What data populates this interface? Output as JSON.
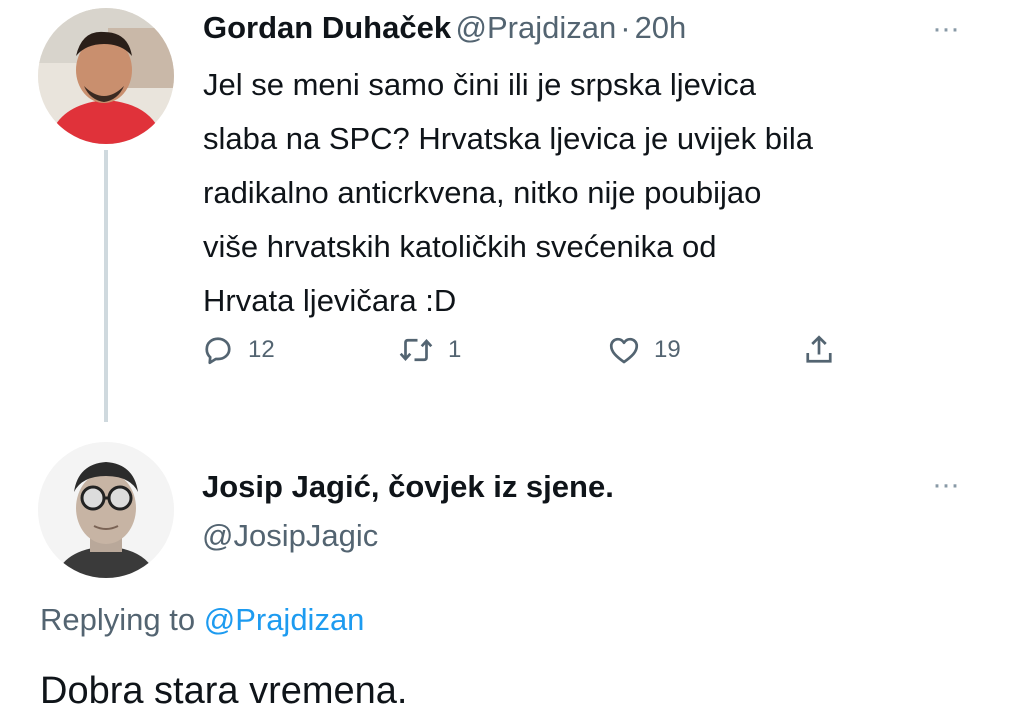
{
  "tweet1": {
    "display_name": "Gordan Duhaček",
    "handle": "@Prajdizan",
    "separator": "·",
    "time": "20h",
    "more_label": "···",
    "text_lines": [
      "Jel se meni samo čini ili je srpska ljevica",
      "slaba na SPC? Hrvatska ljevica je uvijek bila",
      "radikalno anticrkvena, nitko nije poubijao",
      "više hrvatskih katoličkih svećenika od",
      "Hrvata ljevičara :D"
    ],
    "actions": {
      "reply_count": "12",
      "retweet_count": "1",
      "like_count": "19"
    }
  },
  "tweet2": {
    "display_name": "Josip Jagić, čovjek iz sjene.",
    "handle": "@JosipJagic",
    "more_label": "···",
    "replying_prefix": "Replying to",
    "replying_to": "@Prajdizan",
    "text": "Dobra stara vremena."
  },
  "colors": {
    "text_primary": "#0f1419",
    "text_secondary": "#536471",
    "link": "#1d9bf0",
    "thread_line": "#cfd9de"
  },
  "icons": {
    "reply": "reply-icon",
    "retweet": "retweet-icon",
    "like": "like-icon",
    "share": "share-icon",
    "more": "more-icon"
  }
}
